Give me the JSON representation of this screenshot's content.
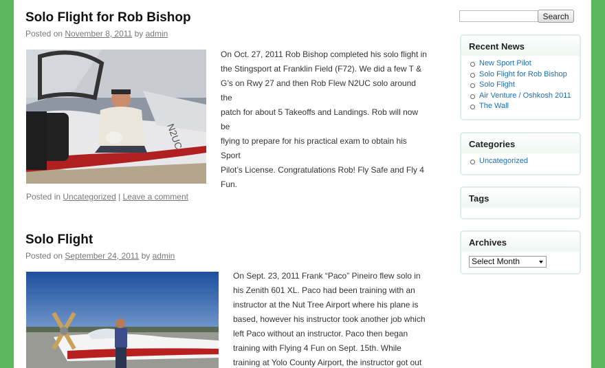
{
  "colors": {
    "page_border": "#5cb85c",
    "link_blue": "#1a6fb5",
    "widget_border": "#dcefe6"
  },
  "posts": [
    {
      "title": "Solo Flight for Rob Bishop",
      "posted_on": "Posted on",
      "date": "November 8, 2011",
      "by": "by",
      "author": "admin",
      "body": [
        "On Oct. 27, 2011 Rob Bishop completed his solo flight in",
        "the Stingsport at Franklin Field (F72).  We did a few T &",
        "G’s on Rwy 27 and then Rob Flew N2UC solo around the",
        "patch for about 5 Takeoffs and Landings.  Rob will now be",
        "flying to prepare for his practical exam to obtain his Sport",
        "Pilot’s License.  Congratulations Rob!  Fly Safe and Fly 4",
        "Fun."
      ],
      "posted_in": "Posted in",
      "category": "Uncategorized",
      "separator": "|",
      "comment_link": "Leave a comment"
    },
    {
      "title": "Solo Flight",
      "posted_on": "Posted on",
      "date": "September 24, 2011",
      "by": "by",
      "author": "admin",
      "body": [
        "On Sept. 23, 2011 Frank “Paco” Pineiro flew solo in",
        "his Zenith 601 XL.  Paco had been training with an",
        "instructor at the Nut Tree Airport where his plane is",
        "based, however his instructor took another job which",
        "left Paco without an instructor.  Paco then began",
        "training with Flying 4 Fun on Sept. 15th.  While",
        "training at Yolo County Airport, the instructor got out"
      ]
    }
  ],
  "search": {
    "placeholder": "",
    "button_label": "Search"
  },
  "sidebar": {
    "recent_news": {
      "title": "Recent News",
      "items": [
        "New Sport Pilot",
        "Solo Flight for Rob Bishop",
        "Solo Flight",
        "Air Venture / Oshkosh 2011",
        "The Wall"
      ]
    },
    "categories": {
      "title": "Categories",
      "items": [
        "Uncategorized"
      ]
    },
    "tags": {
      "title": "Tags"
    },
    "archives": {
      "title": "Archives",
      "select_value": "Select Month"
    }
  }
}
